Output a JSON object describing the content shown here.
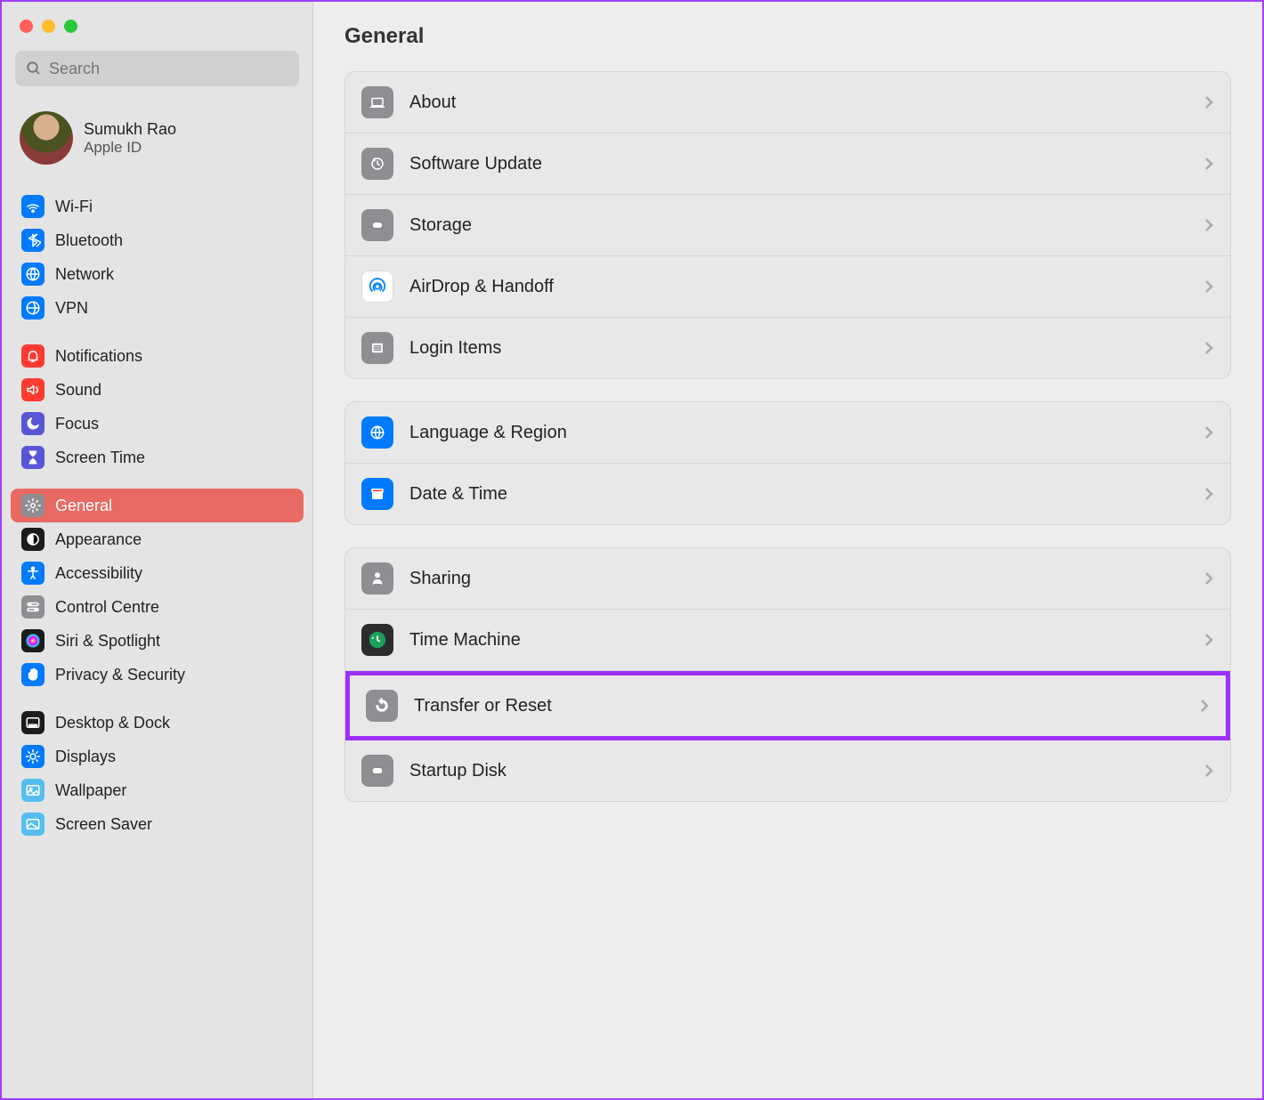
{
  "search": {
    "placeholder": "Search"
  },
  "account": {
    "name": "Sumukh Rao",
    "sub": "Apple ID"
  },
  "sidebar": {
    "groups": [
      {
        "items": [
          {
            "label": "Wi-Fi",
            "icon": "wifi",
            "bg": "#007aff"
          },
          {
            "label": "Bluetooth",
            "icon": "bluetooth",
            "bg": "#007aff"
          },
          {
            "label": "Network",
            "icon": "network",
            "bg": "#007aff"
          },
          {
            "label": "VPN",
            "icon": "vpn",
            "bg": "#007aff"
          }
        ]
      },
      {
        "items": [
          {
            "label": "Notifications",
            "icon": "bell",
            "bg": "#ff3b30"
          },
          {
            "label": "Sound",
            "icon": "sound",
            "bg": "#ff3b30"
          },
          {
            "label": "Focus",
            "icon": "moon",
            "bg": "#5856d6"
          },
          {
            "label": "Screen Time",
            "icon": "hourglass",
            "bg": "#5856d6"
          }
        ]
      },
      {
        "items": [
          {
            "label": "General",
            "icon": "gear",
            "bg": "#8e8e93",
            "selected": true
          },
          {
            "label": "Appearance",
            "icon": "appearance",
            "bg": "#1c1c1e"
          },
          {
            "label": "Accessibility",
            "icon": "accessibility",
            "bg": "#007aff"
          },
          {
            "label": "Control Centre",
            "icon": "switches",
            "bg": "#8e8e93"
          },
          {
            "label": "Siri & Spotlight",
            "icon": "siri",
            "bg": "#1c1c1e"
          },
          {
            "label": "Privacy & Security",
            "icon": "hand",
            "bg": "#007aff"
          }
        ]
      },
      {
        "items": [
          {
            "label": "Desktop & Dock",
            "icon": "dock",
            "bg": "#1c1c1e"
          },
          {
            "label": "Displays",
            "icon": "displays",
            "bg": "#007aff"
          },
          {
            "label": "Wallpaper",
            "icon": "wallpaper",
            "bg": "#55bef0"
          },
          {
            "label": "Screen Saver",
            "icon": "screensaver",
            "bg": "#55bef0"
          }
        ]
      }
    ]
  },
  "main": {
    "title": "General",
    "panels": [
      {
        "rows": [
          {
            "label": "About",
            "icon": "about",
            "bg": "#8e8e93"
          },
          {
            "label": "Software Update",
            "icon": "update",
            "bg": "#8e8e93"
          },
          {
            "label": "Storage",
            "icon": "storage",
            "bg": "#8e8e93"
          },
          {
            "label": "AirDrop & Handoff",
            "icon": "airdrop",
            "bg": "#ffffff"
          },
          {
            "label": "Login Items",
            "icon": "list",
            "bg": "#8e8e93"
          }
        ]
      },
      {
        "rows": [
          {
            "label": "Language & Region",
            "icon": "globe",
            "bg": "#007aff"
          },
          {
            "label": "Date & Time",
            "icon": "calendar",
            "bg": "#007aff"
          }
        ]
      },
      {
        "rows": [
          {
            "label": "Sharing",
            "icon": "sharing",
            "bg": "#8e8e93"
          },
          {
            "label": "Time Machine",
            "icon": "timemachine",
            "bg": "#2c2c2e"
          },
          {
            "label": "Transfer or Reset",
            "icon": "reset",
            "bg": "#8e8e93",
            "highlight": true
          },
          {
            "label": "Startup Disk",
            "icon": "disk",
            "bg": "#8e8e93"
          }
        ]
      }
    ]
  }
}
